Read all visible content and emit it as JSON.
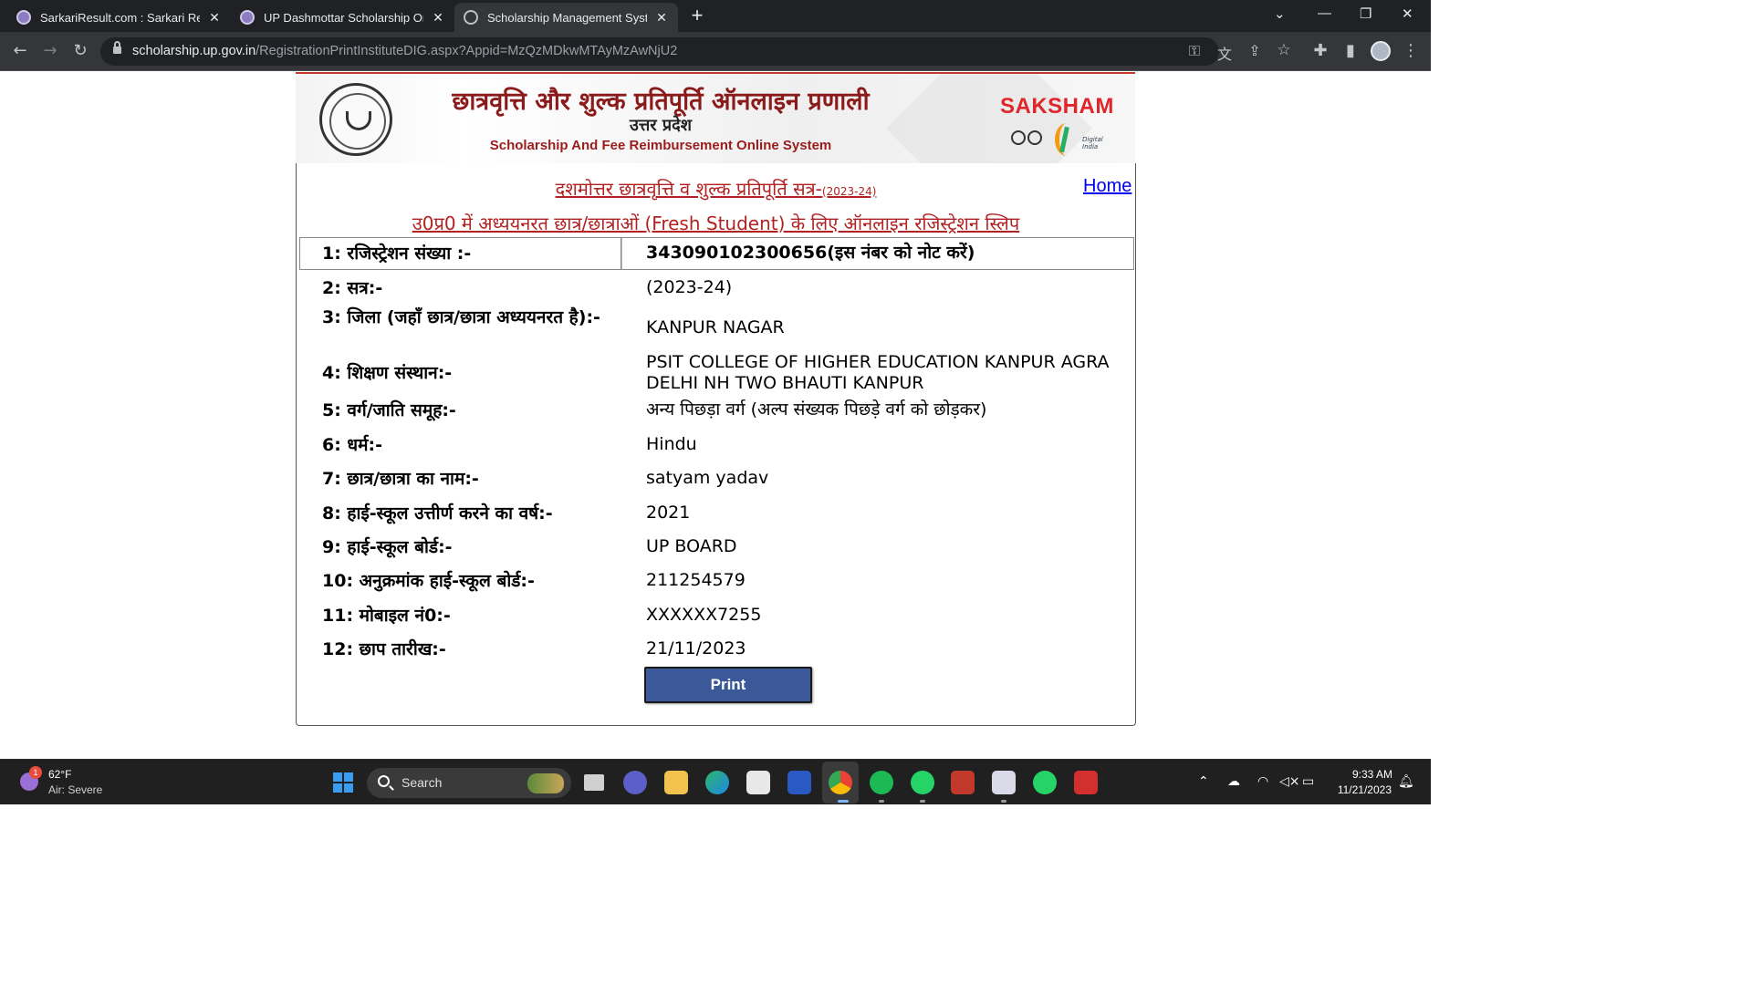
{
  "browser": {
    "tabs": [
      {
        "title": "SarkariResult.com : Sarkari Result",
        "active": false
      },
      {
        "title": "UP Dashmottar Scholarship Online",
        "active": false
      },
      {
        "title": "Scholarship Management System",
        "active": true
      }
    ],
    "new_tab_label": "+",
    "url_host": "scholarship.up.gov.in",
    "url_path": "/RegistrationPrintInstituteDIG.aspx?Appid=MzQzMDkwMTAyMzAwNjU2"
  },
  "banner": {
    "title_hindi": "छात्रवृत्ति और शुल्क प्रतिपूर्ति ऑनलाइन प्रणाली",
    "state_hindi": "उत्तर प्रदेश",
    "title_english": "Scholarship And Fee Reimbursement Online System",
    "saksham": "SAKSHAM",
    "digital_india": "Digital India"
  },
  "page": {
    "heading1": "दशमोत्तर छात्रवृत्ति व शुल्क प्रतिपूर्ति सत्र-",
    "heading1_session": "(2023-24)",
    "heading2": "उ0प्र0 में अध्ययनरत छात्र/छात्राओं (Fresh Student) के लिए ऑनलाइन रजिस्ट्रेशन स्लिप",
    "home_link": "Home",
    "rows": [
      {
        "label": "1: रजिस्ट्रेशन संख्या :-",
        "value": "343090102300656(इस नंबर को नोट करें)"
      },
      {
        "label": "2: सत्र:-",
        "value": "(2023-24)"
      },
      {
        "label": "3: जिला (जहाँ छात्र/छात्रा अध्ययनरत है):-",
        "value": "KANPUR NAGAR"
      },
      {
        "label": "4: शिक्षण संस्थान:-",
        "value": "PSIT COLLEGE OF HIGHER EDUCATION KANPUR AGRA DELHI NH TWO BHAUTI KANPUR"
      },
      {
        "label": "5: वर्ग/जाति समूह:-",
        "value": "अन्य पिछड़ा वर्ग (अल्प संख्यक पिछड़े वर्ग को छोड़कर)"
      },
      {
        "label": "6: धर्म:-",
        "value": "Hindu"
      },
      {
        "label": "7: छात्र/छात्रा का नाम:-",
        "value": "satyam yadav"
      },
      {
        "label": "8: हाई-स्कूल उत्तीर्ण करने का वर्ष:-",
        "value": "2021"
      },
      {
        "label": "9: हाई-स्कूल बोर्ड:-",
        "value": "UP BOARD"
      },
      {
        "label": "10: अनुक्रमांक हाई-स्कूल बोर्ड:-",
        "value": "211254579"
      },
      {
        "label": "11: मोबाइल नं0:-",
        "value": "XXXXXX7255"
      },
      {
        "label": "12: छाप तारीख:-",
        "value": "21/11/2023"
      }
    ],
    "print_button": "Print"
  },
  "taskbar": {
    "weather_badge": "1",
    "weather_temp": "62°F",
    "weather_desc": "Air: Severe",
    "search_label": "Search",
    "time": "9:33 AM",
    "date": "11/21/2023"
  },
  "colors": {
    "heading_red": "#b22222",
    "link_blue": "#0000ee",
    "button_blue": "#3b5998",
    "saksham_red": "#e0262b"
  }
}
